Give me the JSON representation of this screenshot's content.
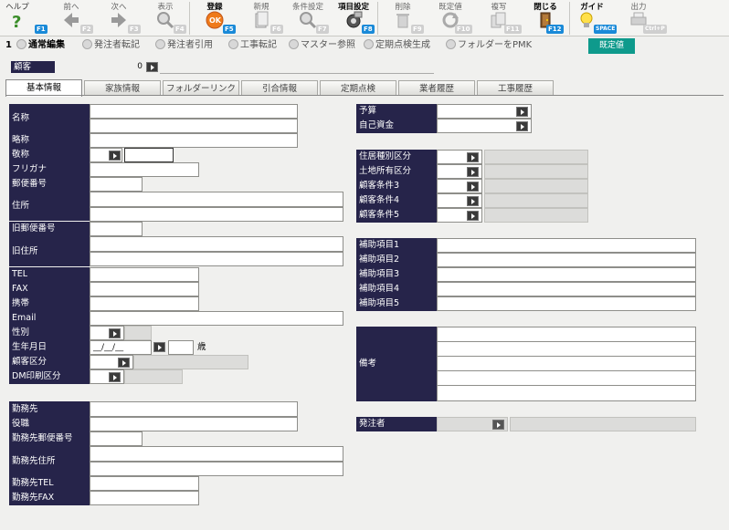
{
  "toolbar": {
    "help": {
      "label": "ヘルプ",
      "key": "F1"
    },
    "prev": {
      "label": "前へ",
      "key": "F2"
    },
    "next": {
      "label": "次へ",
      "key": "F3"
    },
    "view": {
      "label": "表示",
      "key": "F4"
    },
    "register": {
      "label": "登録",
      "key": "F5"
    },
    "new": {
      "label": "新規",
      "key": "F6"
    },
    "condition": {
      "label": "条件設定",
      "key": "F7"
    },
    "items": {
      "label": "項目設定",
      "key": "F8"
    },
    "delete": {
      "label": "削除",
      "key": "F9"
    },
    "default": {
      "label": "既定値",
      "key": "F10"
    },
    "copy": {
      "label": "複写",
      "key": "F11"
    },
    "close": {
      "label": "閉じる",
      "key": "F12"
    },
    "guide": {
      "label": "ガイド",
      "key": "SPACE"
    },
    "output": {
      "label": "出力",
      "key": "Ctrl+P"
    }
  },
  "row2": {
    "num": "1",
    "normal_edit": "通常編集",
    "orderer_transfer": "発注者転記",
    "orderer_cite": "発注者引用",
    "work_transfer": "工事転記",
    "master_ref": "マスター参照",
    "periodic_gen": "定期点検生成",
    "folder_pmk": "フォルダーをPMK",
    "default_btn": "既定値"
  },
  "customer": {
    "label": "顧客",
    "value": "0"
  },
  "tabs": [
    "基本情報",
    "家族情報",
    "フォルダーリンク",
    "引合情報",
    "定期点検",
    "業者履歴",
    "工事履歴"
  ],
  "left_labels": {
    "name": "名称",
    "short": "略称",
    "honorific": "敬称",
    "furigana": "フリガナ",
    "zip": "郵便番号",
    "address": "住所",
    "old_zip": "旧郵便番号",
    "old_address": "旧住所",
    "tel": "TEL",
    "fax": "FAX",
    "mobile": "携帯",
    "email": "Email",
    "sex": "性別",
    "birth": "生年月日",
    "cust_class": "顧客区分",
    "dm_class": "DM印刷区分",
    "work": "勤務先",
    "position": "役職",
    "work_zip": "勤務先郵便番号",
    "work_address": "勤務先住所",
    "work_tel": "勤務先TEL",
    "work_fax": "勤務先FAX"
  },
  "birth": {
    "placeholder": "__/__/__",
    "age_unit": "歳"
  },
  "right_labels": {
    "budget": "予算",
    "own_funds": "自己資金",
    "house_type": "住居種別区分",
    "land_owner": "土地所有区分",
    "cond3": "顧客条件3",
    "cond4": "顧客条件4",
    "cond5": "顧客条件5",
    "aux1": "補助項目1",
    "aux2": "補助項目2",
    "aux3": "補助項目3",
    "aux4": "補助項目4",
    "aux5": "補助項目5",
    "remarks": "備考",
    "orderer": "発注者"
  },
  "colors": {
    "label_bg": "#26244a",
    "default_btn": "#0e9a8c",
    "fkey": "#1a8ad8"
  }
}
